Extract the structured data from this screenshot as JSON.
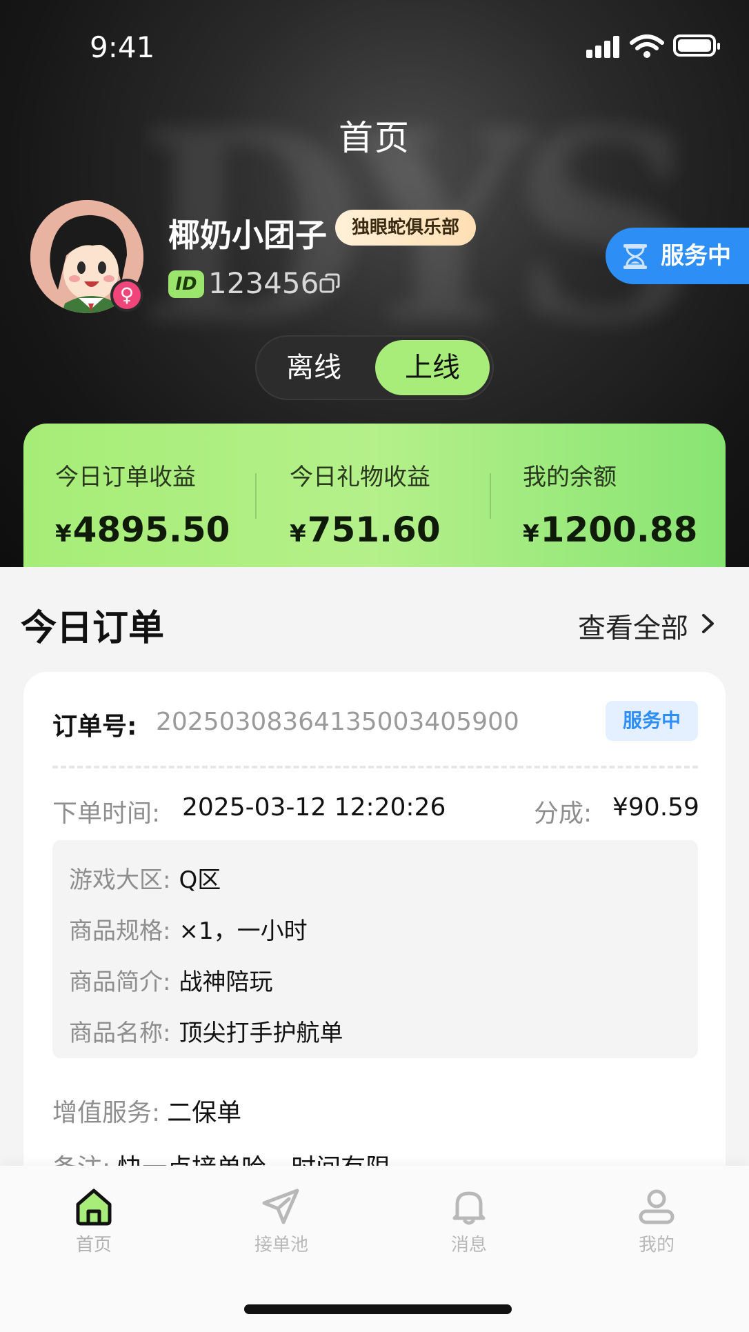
{
  "status_bar": {
    "time": "9:41"
  },
  "header": {
    "title": "首页"
  },
  "profile": {
    "nickname": "椰奶小团子",
    "club": "独眼蛇俱乐部",
    "id_badge": "ID",
    "id": "123456",
    "gender_symbol": "♀"
  },
  "service_status": {
    "label": "服务中"
  },
  "online_toggle": {
    "offline": "离线",
    "online": "上线",
    "selected": "上线"
  },
  "earnings": [
    {
      "label": "今日订单收益",
      "currency": "¥",
      "amount": "4895.50"
    },
    {
      "label": "今日礼物收益",
      "currency": "¥",
      "amount": "751.60"
    },
    {
      "label": "我的余额",
      "currency": "¥",
      "amount": "1200.88"
    }
  ],
  "today_orders": {
    "title": "今日订单",
    "view_all": "查看全部",
    "order": {
      "order_no_label": "订单号:",
      "order_no": "2025030836413500340590​0",
      "status": "服务中",
      "time_label": "下单时间:",
      "time": "2025-03-12 12:20:26",
      "share_label": "分成:",
      "share": "¥90.59",
      "details": [
        {
          "key": "游戏大区:",
          "value": "Q区"
        },
        {
          "key": "商品规格:",
          "value": "×1，一小时"
        },
        {
          "key": "商品简介:",
          "value": "战神陪玩"
        },
        {
          "key": "商品名称:",
          "value": "顶尖打手护航单"
        }
      ],
      "vas_label": "增值服务:",
      "vas": "二保单",
      "note_label": "备注:",
      "note": "快一点接单哈，时间有限"
    }
  },
  "tabbar": {
    "items": [
      {
        "label": "首页",
        "icon": "home-icon",
        "active": true
      },
      {
        "label": "接单池",
        "icon": "send-icon",
        "active": false
      },
      {
        "label": "消息",
        "icon": "bell-icon",
        "active": false
      },
      {
        "label": "我的",
        "icon": "user-icon",
        "active": false
      }
    ]
  },
  "colors": {
    "accent_green": "#a8ec7a",
    "accent_blue": "#2d8ef5"
  }
}
